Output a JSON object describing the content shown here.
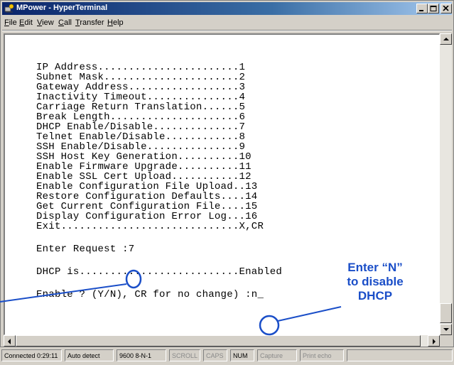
{
  "window": {
    "title": "MPower - HyperTerminal",
    "controls": {
      "minimize": "minimize-icon",
      "maximize": "maximize-icon",
      "close": "close-icon"
    }
  },
  "menu": [
    {
      "label": "File",
      "accel": "F",
      "rest": "ile"
    },
    {
      "label": "Edit",
      "accel": "E",
      "rest": "dit"
    },
    {
      "label": "View",
      "accel": "V",
      "rest": "iew"
    },
    {
      "label": "Call",
      "accel": "C",
      "rest": "all"
    },
    {
      "label": "Transfer",
      "accel": "T",
      "rest": "ransfer"
    },
    {
      "label": "Help",
      "accel": "H",
      "rest": "elp"
    }
  ],
  "terminal": {
    "menu_lines": [
      "IP Address.......................1",
      "Subnet Mask......................2",
      "Gateway Address..................3",
      "Inactivity Timeout...............4",
      "Carriage Return Translation......5",
      "Break Length.....................6",
      "DHCP Enable/Disable..............7",
      "Telnet Enable/Disable............8",
      "SSH Enable/Disable...............9",
      "SSH Host Key Generation..........10",
      "Enable Firmware Upgrade..........11",
      "Enable SSL Cert Upload...........12",
      "Enable Configuration File Upload..13",
      "Restore Configuration Defaults....14",
      "Get Current Configuration File....15",
      "Display Configuration Error Log...16",
      "Exit.............................X,CR"
    ],
    "enter_request": "Enter Request :7",
    "dhcp_status": "DHCP is..........................Enabled",
    "enable_prompt": "Enable ? (Y/N), CR for no change) :n_"
  },
  "annotation": {
    "callout_lines": [
      "Enter “N”",
      "to disable",
      "DHCP"
    ],
    "color": "#1a4ec8"
  },
  "status": {
    "connected": "Connected 0:29:11",
    "detect": "Auto detect",
    "settings": "9600 8-N-1",
    "scroll": "SCROLL",
    "caps": "CAPS",
    "num": "NUM",
    "capture": "Capture",
    "print_echo": "Print echo"
  }
}
